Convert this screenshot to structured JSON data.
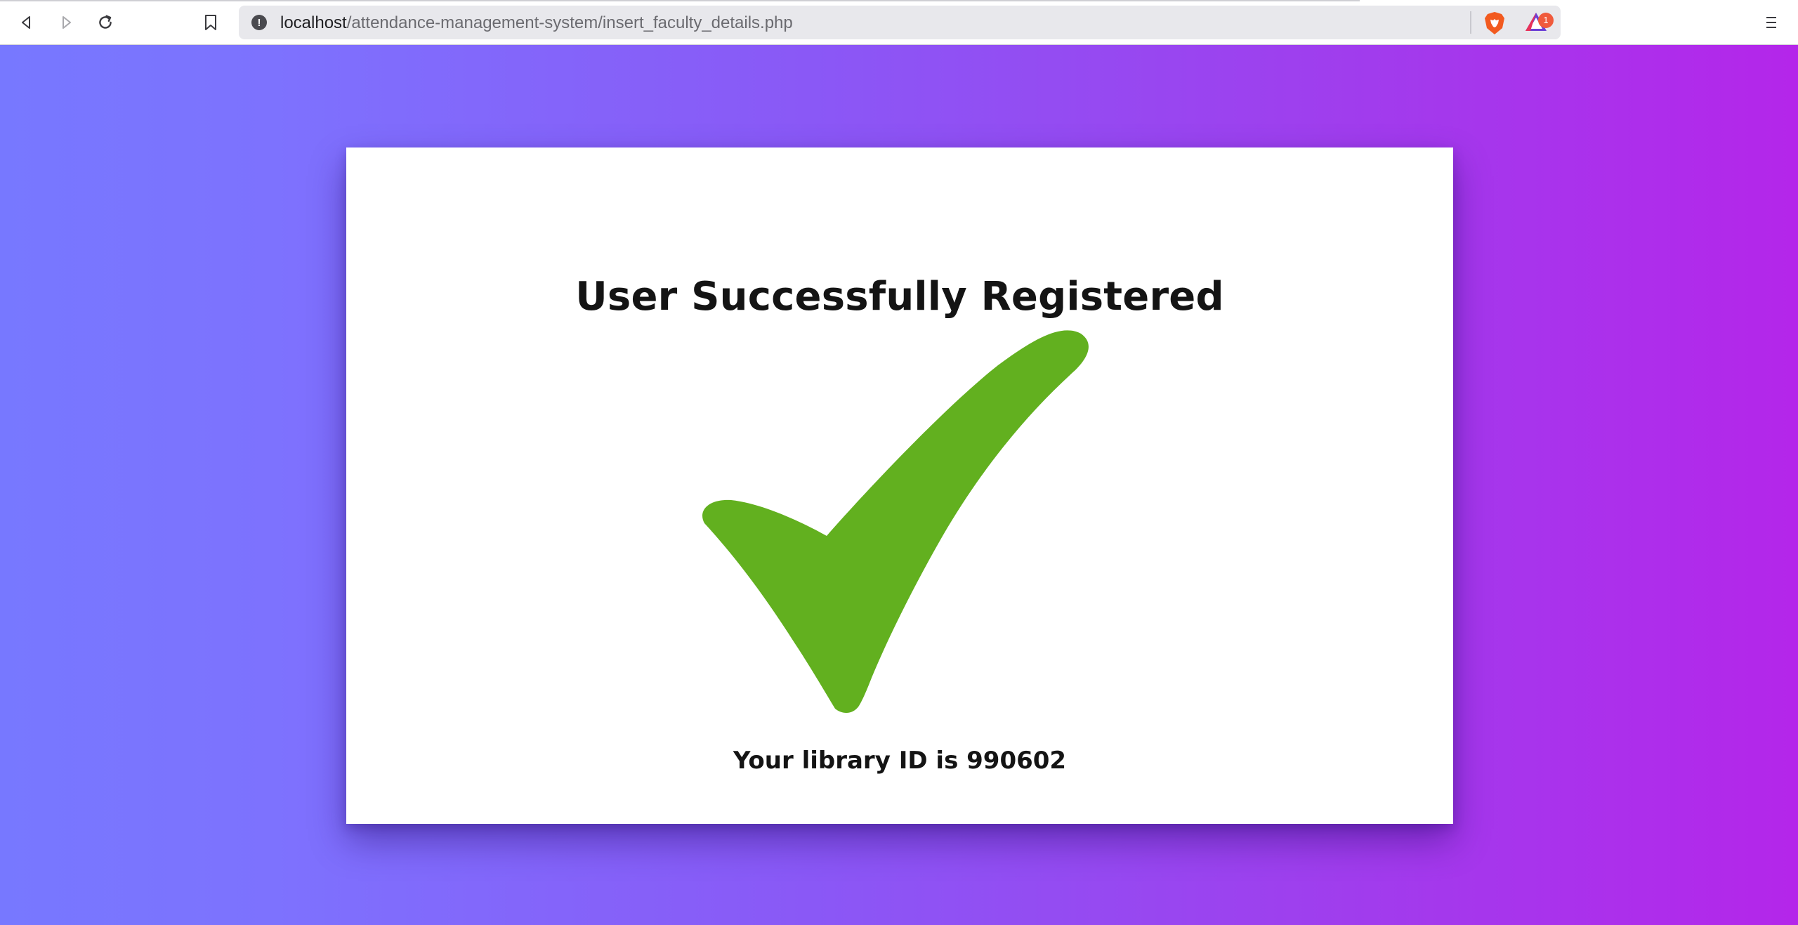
{
  "browser": {
    "url_host": "localhost",
    "url_path": "/attendance-management-system/insert_faculty_details.php",
    "rewards_badge": "1",
    "icons": {
      "back": "back-arrow-icon",
      "forward": "forward-arrow-icon",
      "reload": "reload-icon",
      "bookmark": "bookmark-icon",
      "site_info": "info-icon",
      "shield": "brave-shield-icon",
      "rewards": "brave-rewards-icon",
      "menu": "hamburger-menu-icon"
    }
  },
  "page": {
    "title": "User Successfully Registered",
    "library_id_text": "Your library ID is 990602",
    "colors": {
      "gradient_start": "#7778ff",
      "gradient_end": "#b426ea",
      "check_green": "#62b01f",
      "card_bg": "#ffffff"
    }
  }
}
